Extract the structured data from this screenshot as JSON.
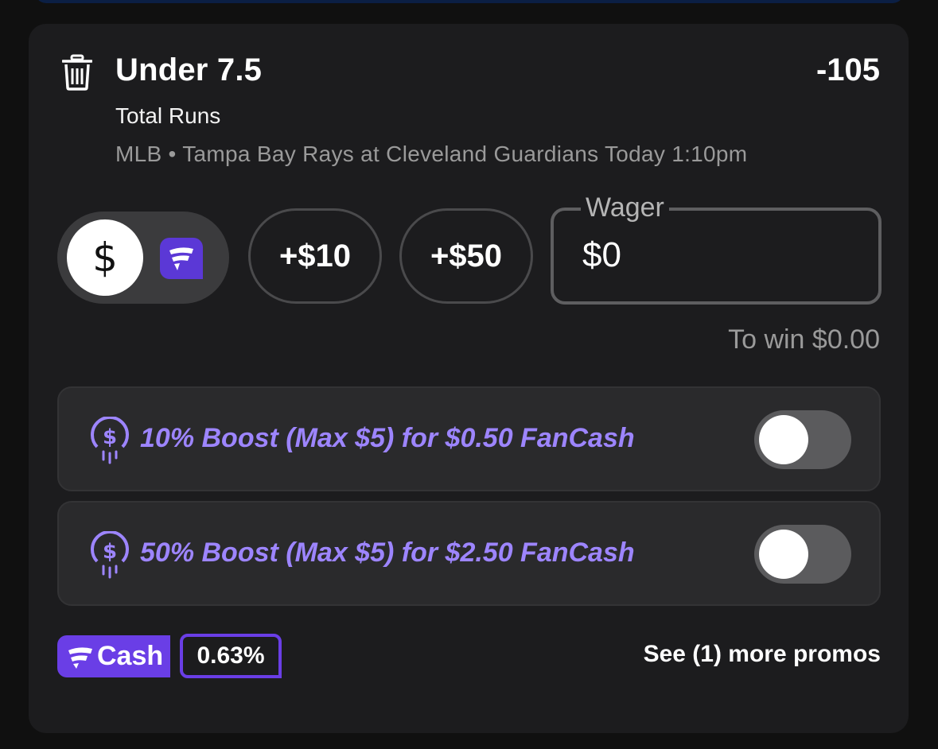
{
  "bet": {
    "selection": "Under 7.5",
    "odds": "-105",
    "market": "Total Runs",
    "event": "MLB • Tampa Bay Rays at Cleveland Guardians Today 1:10pm"
  },
  "wager": {
    "currency_symbol": "$",
    "quick_add": [
      "+$10",
      "+$50"
    ],
    "label": "Wager",
    "value": "$0",
    "to_win": "To win $0.00"
  },
  "promos": [
    {
      "text": "10% Boost (Max $5) for $0.50 FanCash",
      "enabled": false
    },
    {
      "text": "50% Boost (Max $5) for $2.50 FanCash",
      "enabled": false
    }
  ],
  "footer": {
    "fancash_label": "Cash",
    "fancash_percent": "0.63%",
    "more_promos": "See (1) more promos"
  },
  "colors": {
    "card_bg": "#1c1c1e",
    "accent_purple": "#6a3ee6",
    "promo_text": "#9d85ff"
  },
  "icons": [
    "trash-icon",
    "fancash-logo-icon",
    "boost-coin-icon"
  ]
}
